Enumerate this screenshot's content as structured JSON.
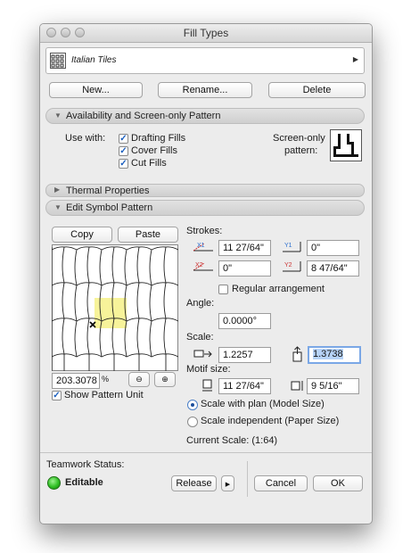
{
  "window": {
    "title": "Fill Types"
  },
  "fill_selector": {
    "name": "Italian Tiles",
    "arrow_icon": "triangle-right-icon"
  },
  "buttons": {
    "new": "New...",
    "rename": "Rename...",
    "delete": "Delete"
  },
  "availability": {
    "header": "Availability and Screen-only Pattern",
    "use_with_label": "Use with:",
    "options": [
      {
        "label": "Drafting Fills",
        "checked": true
      },
      {
        "label": "Cover Fills",
        "checked": true
      },
      {
        "label": "Cut Fills",
        "checked": true
      }
    ],
    "screen_only_label_1": "Screen-only",
    "screen_only_label_2": "pattern:"
  },
  "thermal": {
    "header": "Thermal Properties"
  },
  "edit_symbol": {
    "header": "Edit Symbol Pattern",
    "copy": "Copy",
    "paste": "Paste",
    "zoom_value": "203.3078",
    "zoom_unit": "%",
    "show_pattern_unit": "Show Pattern Unit",
    "show_pattern_unit_checked": true,
    "strokes_label": "Strokes:",
    "x1": "11 27/64\"",
    "y1": "0\"",
    "x2": "0\"",
    "y2": "8 47/64\"",
    "regular_arrangement": "Regular arrangement",
    "regular_arrangement_checked": false,
    "angle_label": "Angle:",
    "angle": "0.0000°",
    "scale_label": "Scale:",
    "scale_x": "1.2257",
    "scale_y": "1.3738",
    "motif_label": "Motif size:",
    "motif_w": "11 27/64\"",
    "motif_h": "9 5/16\"",
    "scale_with_plan": "Scale with plan (Model Size)",
    "scale_independent": "Scale independent (Paper Size)",
    "scale_mode_selected": "scale_with_plan",
    "current_scale": "Current Scale: (1:64)"
  },
  "footer": {
    "teamwork_label": "Teamwork Status:",
    "status": "Editable",
    "status_color": "#2fbf23",
    "release": "Release",
    "cancel": "Cancel",
    "ok": "OK"
  }
}
